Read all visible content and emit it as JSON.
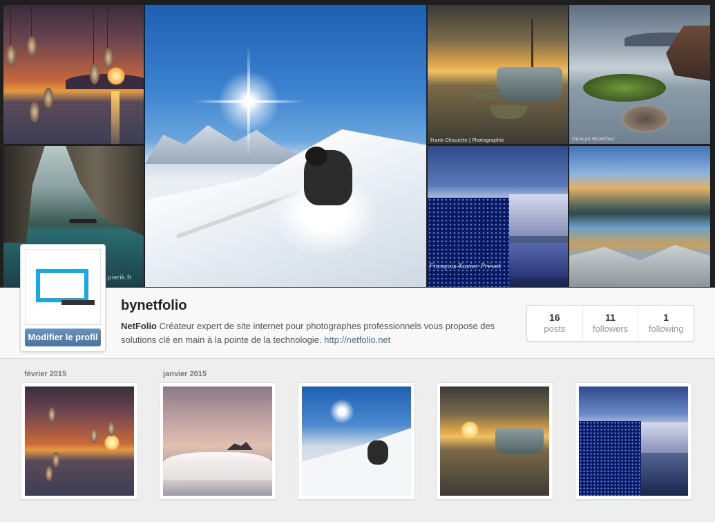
{
  "cover": {
    "photo_captions": {
      "cave": ".pierik.fr",
      "marseille": "François-Xavier Prévot",
      "coast": "Duncan McArthur",
      "harbor": "Frank Chouette | Photographie"
    }
  },
  "profile": {
    "username": "bynetfolio",
    "edit_button": "Modifier le profil",
    "bio_name": "NetFolio",
    "bio_text": "Créateur expert de site internet pour photographes professionnels vous propose des solutions clé en main à la pointe de la technologie.",
    "bio_link": "http://netfolio.net",
    "avatar_colors": {
      "frame": "#1aa8e0",
      "bar": "#333333"
    },
    "stats": [
      {
        "count": "16",
        "label": "posts"
      },
      {
        "count": "11",
        "label": "followers"
      },
      {
        "count": "1",
        "label": "following"
      }
    ]
  },
  "feed": {
    "months": [
      "février 2015",
      "janvier 2015"
    ],
    "posts": [
      {
        "subject": "sunset-feathers"
      },
      {
        "subject": "cloud-sea"
      },
      {
        "subject": "skier"
      },
      {
        "subject": "harbor-boat"
      },
      {
        "subject": "marseille-night"
      }
    ]
  },
  "colors": {
    "link": "#3f729b",
    "button": "#4a72a0",
    "background": "#eeeeee"
  }
}
